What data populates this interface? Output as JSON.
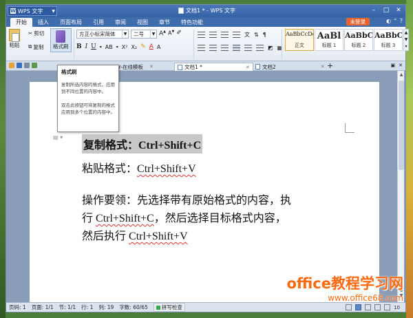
{
  "window": {
    "app_menu": "WPS 文字",
    "doc_title": "文档1 * - WPS 文字"
  },
  "ribbon_tabs": [
    "开始",
    "插入",
    "页面布局",
    "引用",
    "审阅",
    "视图",
    "章节",
    "特色功能"
  ],
  "login_label": "未登录",
  "ribbon": {
    "paste": "粘贴",
    "cut": "剪切",
    "copy": "复制",
    "format_painter": "格式刷",
    "font_name": "方正小标宋简体",
    "font_size": "二号"
  },
  "styles": [
    {
      "sample": "AaBbCcDd",
      "label": "正文"
    },
    {
      "sample": "AaBl",
      "label": "标题 1"
    },
    {
      "sample": "AaBbC",
      "label": "标题 2"
    },
    {
      "sample": "AaBbC",
      "label": "标题 3"
    }
  ],
  "doc_tabs": [
    {
      "label": "er-在线模板"
    },
    {
      "label": "文档1 *"
    },
    {
      "label": "文档2"
    }
  ],
  "tooltip": {
    "title": "格式刷",
    "p1": "复制所选内容的格式，应用到不同位置的内容中。",
    "p2": "双击此按钮可将复制的格式应用到多个位置的内容中。"
  },
  "document": {
    "line1": "复制格式：Ctrl+Shift+C",
    "line2_prefix": "粘贴格式：",
    "line2_shortcut": "Ctrl+Shift+V",
    "para_a": "操作要领：先选择带有原始格式的内容，执",
    "para_b_pre": "行 ",
    "para_b_sc": "Ctrl+Shift+C",
    "para_b_post": "，然后选择目标格式内容，",
    "para_c_pre": "然后执行 ",
    "para_c_sc": "Ctrl+Shift+V"
  },
  "status": {
    "page": "页码: 1",
    "pages": "页面: 1/1",
    "section": "节: 1/1",
    "row": "行: 1",
    "col": "列: 19",
    "words": "字数: 60/65",
    "spell": "拼写检查",
    "zoom": "10"
  },
  "watermark": {
    "line1": "office教程学习网",
    "line2": "www.office68.com"
  },
  "colors": {
    "title_bar": "#3463a6",
    "login_button": "#e8642e",
    "watermark": "#ff6a10",
    "selection": "#c8c8c8"
  }
}
